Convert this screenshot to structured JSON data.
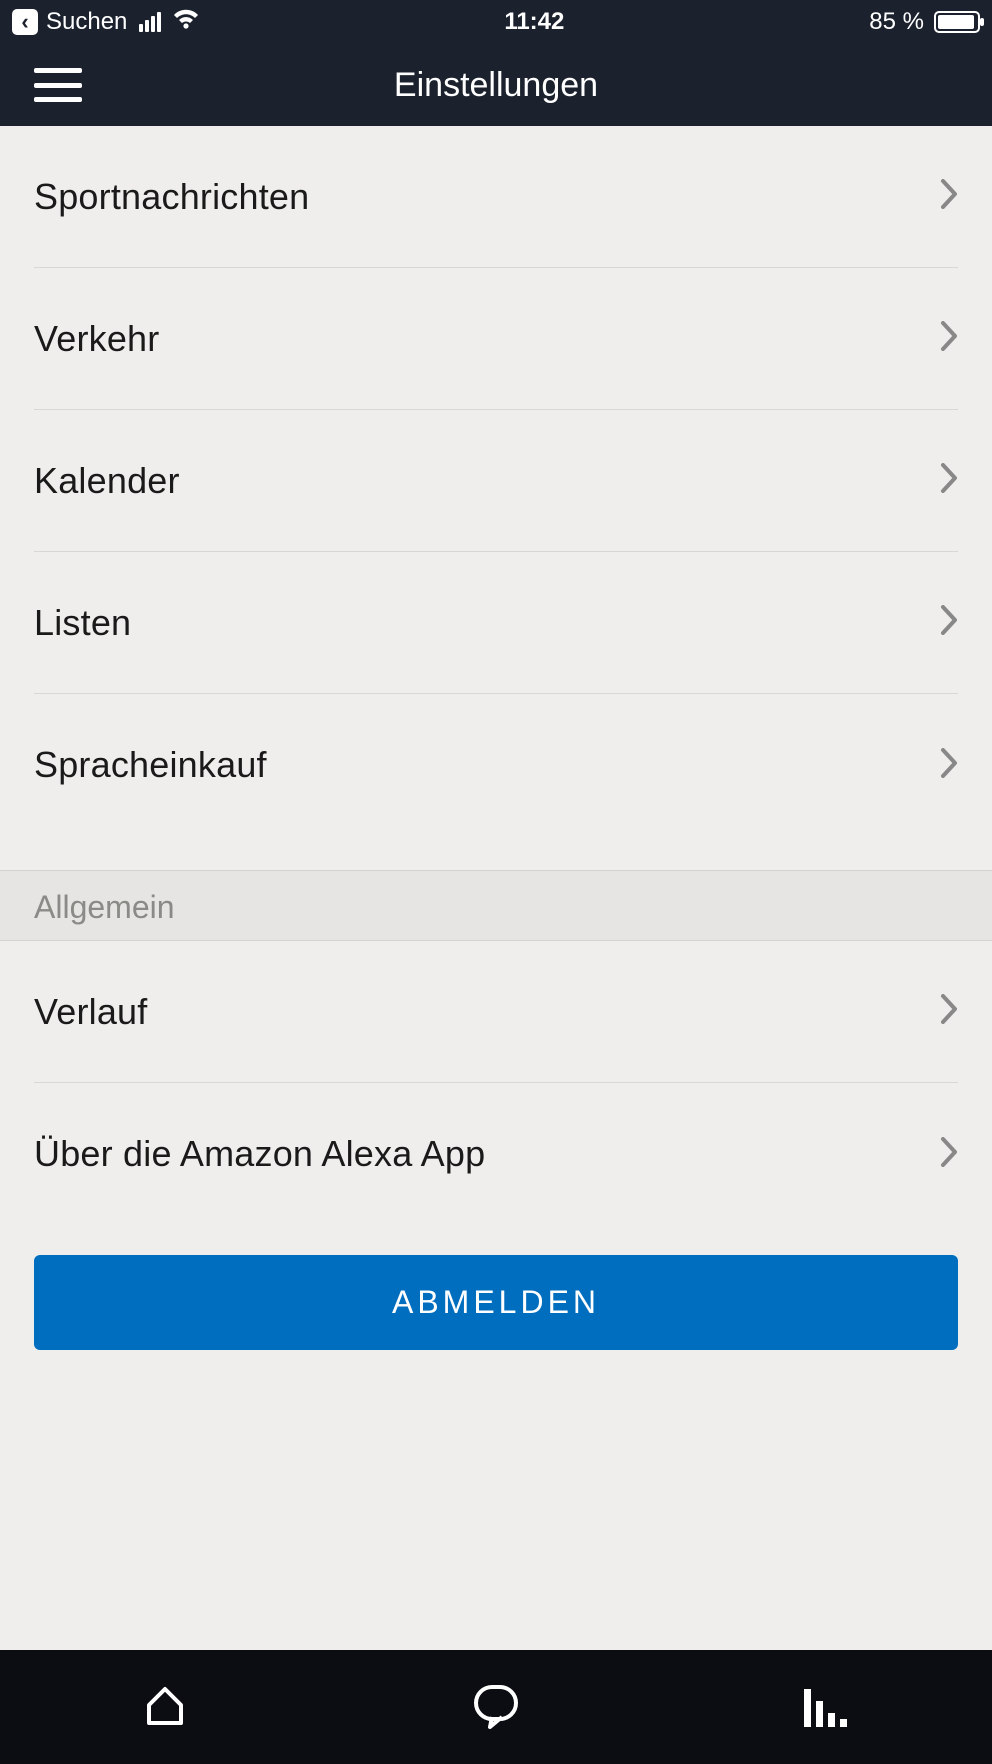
{
  "status": {
    "back_label": "Suchen",
    "time": "11:42",
    "battery_pct": "85 %"
  },
  "header": {
    "title": "Einstellungen"
  },
  "settings_primary": [
    "Sportnachrichten",
    "Verkehr",
    "Kalender",
    "Listen",
    "Spracheinkauf"
  ],
  "section_general_title": "Allgemein",
  "settings_general": [
    "Verlauf",
    "Über die Amazon Alexa App"
  ],
  "logout_label": "ABMELDEN"
}
